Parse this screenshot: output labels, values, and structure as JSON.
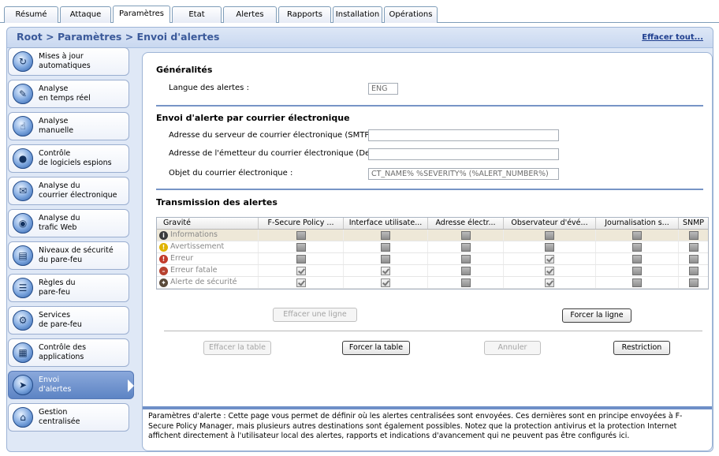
{
  "tabs": [
    {
      "label": "Résumé",
      "active": false
    },
    {
      "label": "Attaque",
      "active": false
    },
    {
      "label": "Paramètres",
      "active": true
    },
    {
      "label": "Etat",
      "active": false
    },
    {
      "label": "Alertes",
      "active": false
    },
    {
      "label": "Rapports",
      "active": false
    },
    {
      "label": "Installation",
      "active": false
    },
    {
      "label": "Opérations",
      "active": false
    }
  ],
  "breadcrumb": {
    "text": "Root > Paramètres > Envoi d'alertes",
    "clear_all": "Effacer tout..."
  },
  "sidebar": {
    "items": [
      {
        "label1": "Mises à jour",
        "label2": "automatiques",
        "icon": "update-icon",
        "active": false
      },
      {
        "label1": "Analyse",
        "label2": "en temps réel",
        "icon": "realtime-scan-icon",
        "active": false
      },
      {
        "label1": "Analyse",
        "label2": "manuelle",
        "icon": "manual-scan-icon",
        "active": false
      },
      {
        "label1": "Contrôle",
        "label2": "de logiciels espions",
        "icon": "spyware-icon",
        "active": false
      },
      {
        "label1": "Analyse du",
        "label2": "courrier électronique",
        "icon": "email-scan-icon",
        "active": false
      },
      {
        "label1": "Analyse du",
        "label2": "trafic Web",
        "icon": "web-scan-icon",
        "active": false
      },
      {
        "label1": "Niveaux de sécurité",
        "label2": "du pare-feu",
        "icon": "firewall-level-icon",
        "active": false
      },
      {
        "label1": "Règles du",
        "label2": "pare-feu",
        "icon": "firewall-rules-icon",
        "active": false
      },
      {
        "label1": "Services",
        "label2": "de pare-feu",
        "icon": "firewall-services-icon",
        "active": false
      },
      {
        "label1": "Contrôle des",
        "label2": "applications",
        "icon": "app-control-icon",
        "active": false
      },
      {
        "label1": "Envoi",
        "label2": "d'alertes",
        "icon": "alert-forwarding-icon",
        "active": true
      },
      {
        "label1": "Gestion",
        "label2": "centralisée",
        "icon": "central-management-icon",
        "active": false
      }
    ]
  },
  "general": {
    "title": "Généralités",
    "language_label": "Langue des alertes :",
    "language_value": "ENG"
  },
  "email": {
    "title": "Envoi d'alerte par courrier électronique",
    "smtp_label": "Adresse du serveur de courrier électronique (SMTP) :",
    "smtp_value": "",
    "from_label": "Adresse de l'émetteur du courrier électronique (De) :",
    "from_value": "",
    "subject_label": "Objet du courrier électronique :",
    "subject_value": "CT_NAME% %SEVERITY% (%ALERT_NUMBER%)"
  },
  "forwarding": {
    "title": "Transmission des alertes",
    "columns": [
      "Gravité",
      "F-Secure Policy ...",
      "Interface utilisate...",
      "Adresse électr...",
      "Observateur d'évé...",
      "Journalisation s...",
      "SNMP"
    ],
    "rows": [
      {
        "label": "Informations",
        "icon": "info-icon",
        "checks": [
          false,
          false,
          false,
          false,
          false,
          false
        ]
      },
      {
        "label": "Avertissement",
        "icon": "warning-icon",
        "checks": [
          false,
          false,
          false,
          false,
          false,
          false
        ]
      },
      {
        "label": "Erreur",
        "icon": "error-icon",
        "checks": [
          false,
          false,
          false,
          true,
          false,
          false
        ]
      },
      {
        "label": "Erreur fatale",
        "icon": "fatal-error-icon",
        "checks": [
          true,
          true,
          false,
          true,
          false,
          false
        ]
      },
      {
        "label": "Alerte de sécurité",
        "icon": "security-alert-icon",
        "checks": [
          true,
          true,
          false,
          true,
          false,
          false
        ]
      }
    ]
  },
  "buttons": {
    "clear_row": "Effacer une ligne",
    "force_row": "Forcer la ligne",
    "clear_table": "Effacer la table",
    "force_table": "Forcer la table",
    "cancel": "Annuler",
    "restriction": "Restriction"
  },
  "footer": {
    "text": "Paramètres d'alerte : Cette page vous permet de définir où les alertes centralisées sont envoyées. Ces dernières sont en principe envoyées à F-Secure Policy Manager, mais plusieurs autres destinations sont également possibles. Notez que la protection antivirus et la protection Internet affichent directement à l'utilisateur local des alertes, rapports et indications d'avancement qui ne peuvent pas être configurés ici."
  },
  "colors": {
    "accent": "#3b5a9a",
    "active_nav": "#5d84c4",
    "rule": "#7794c6"
  }
}
